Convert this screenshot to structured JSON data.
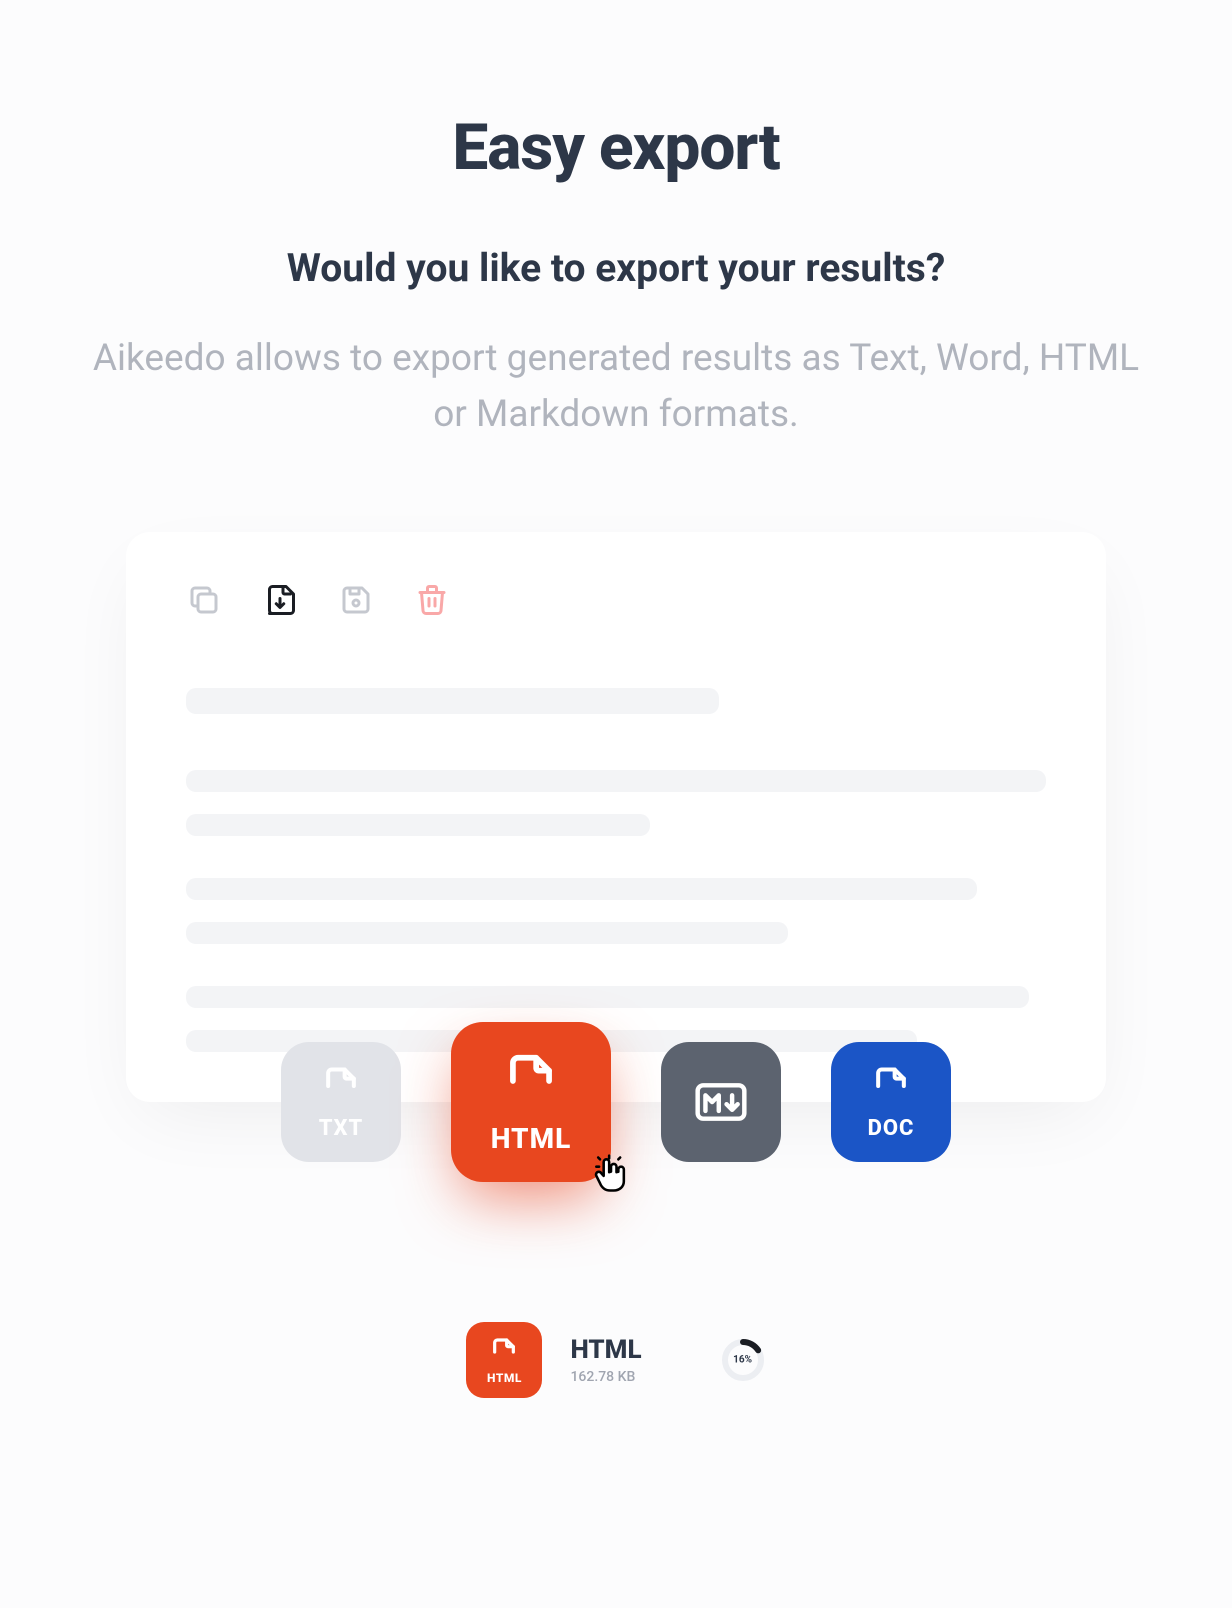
{
  "header": {
    "title": "Easy export",
    "subtitle": "Would you like to export your results?",
    "description": "Aikeedo allows to export generated results as Text, Word, HTML or Markdown formats."
  },
  "toolbar": {
    "icons": [
      "copy",
      "download",
      "save",
      "delete"
    ]
  },
  "exportTiles": [
    {
      "label": "TXT",
      "color": "#e1e3e8"
    },
    {
      "label": "HTML",
      "color": "#e8471f"
    },
    {
      "label": "MD",
      "color": "#5c636f"
    },
    {
      "label": "DOC",
      "color": "#1b55c6"
    }
  ],
  "download": {
    "name": "HTML",
    "size": "162.78 KB",
    "progress": "16%",
    "progressValue": 16
  },
  "colors": {
    "accent": "#e8471f",
    "textPrimary": "#2d3748",
    "textMuted": "#b0b4bd",
    "skeleton": "#f3f4f6",
    "delete": "#f9a8a8"
  }
}
